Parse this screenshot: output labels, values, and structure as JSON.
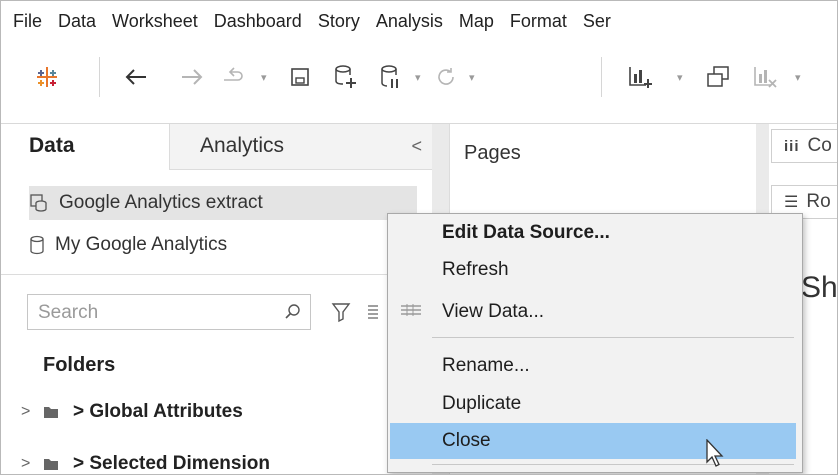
{
  "menubar": {
    "items": [
      "File",
      "Data",
      "Worksheet",
      "Dashboard",
      "Story",
      "Analysis",
      "Map",
      "Format",
      "Ser"
    ]
  },
  "toolbar": {
    "icons": [
      "tableau-logo-icon",
      "undo-icon",
      "redo-icon",
      "replay-icon",
      "save-icon",
      "new-data-source-icon",
      "pause-updates-icon",
      "refresh-icon",
      "new-worksheet-icon",
      "duplicate-sheet-icon",
      "clear-sheet-icon"
    ]
  },
  "left_pane": {
    "tab_data": "Data",
    "tab_analytics": "Analytics",
    "collapse_glyph": "<",
    "data_sources": [
      "Google Analytics extract",
      "My Google Analytics"
    ],
    "search_placeholder": "Search",
    "folders_heading": "Folders",
    "folders": [
      "> Global Attributes",
      "> Selected Dimension"
    ]
  },
  "pages_panel": {
    "label": "Pages"
  },
  "shelves": {
    "columns_fragment": "Co",
    "rows_fragment": "Ro"
  },
  "sheet_title_fragment": "Sh",
  "context_menu": {
    "items": {
      "edit": "Edit Data Source...",
      "refresh": "Refresh",
      "view": "View Data...",
      "rename": "Rename...",
      "duplicate": "Duplicate",
      "close": "Close"
    },
    "hover_color": "#99c9f2"
  }
}
